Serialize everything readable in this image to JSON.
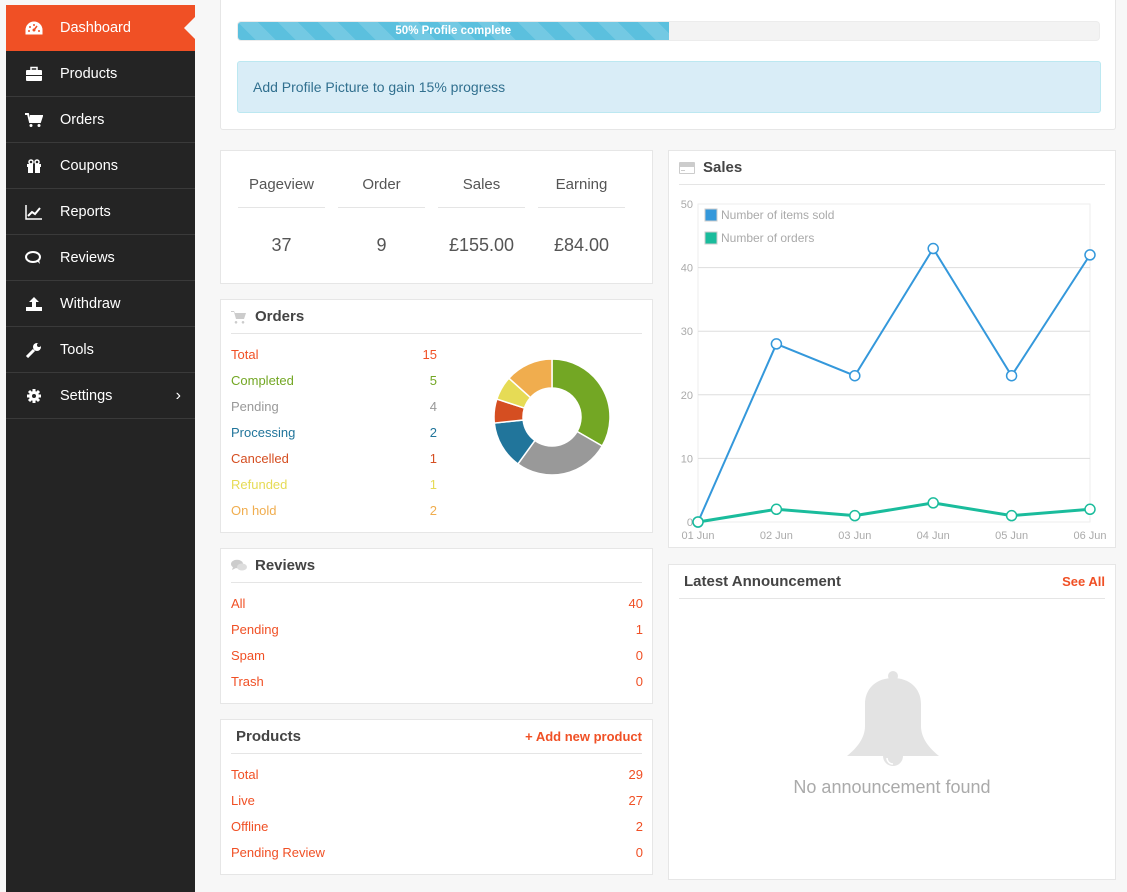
{
  "sidebar": {
    "items": [
      {
        "label": "Dashboard",
        "icon": "dashboard-icon",
        "active": true
      },
      {
        "label": "Products",
        "icon": "briefcase-icon"
      },
      {
        "label": "Orders",
        "icon": "cart-icon"
      },
      {
        "label": "Coupons",
        "icon": "gift-icon"
      },
      {
        "label": "Reports",
        "icon": "line-chart-icon"
      },
      {
        "label": "Reviews",
        "icon": "comments-icon"
      },
      {
        "label": "Withdraw",
        "icon": "upload-icon"
      },
      {
        "label": "Tools",
        "icon": "wrench-icon"
      },
      {
        "label": "Settings",
        "icon": "gear-icon",
        "chevron": "›"
      }
    ]
  },
  "profile": {
    "progress_label": "50% Profile complete",
    "progress_percent": 50,
    "hint": "Add Profile Picture to gain 15% progress"
  },
  "stats": [
    {
      "label": "Pageview",
      "value": "37"
    },
    {
      "label": "Order",
      "value": "9"
    },
    {
      "label": "Sales",
      "value": "£155.00"
    },
    {
      "label": "Earning",
      "value": "£84.00"
    }
  ],
  "orders": {
    "title": "Orders",
    "rows": [
      {
        "label": "Total",
        "value": "15",
        "color": "#f05025"
      },
      {
        "label": "Completed",
        "value": "5",
        "color": "#73a724"
      },
      {
        "label": "Pending",
        "value": "4",
        "color": "#999999"
      },
      {
        "label": "Processing",
        "value": "2",
        "color": "#21759b"
      },
      {
        "label": "Cancelled",
        "value": "1",
        "color": "#d54e21"
      },
      {
        "label": "Refunded",
        "value": "1",
        "color": "#e6db55"
      },
      {
        "label": "On hold",
        "value": "2",
        "color": "#f0ad4e"
      }
    ]
  },
  "reviews": {
    "title": "Reviews",
    "rows": [
      {
        "label": "All",
        "value": "40"
      },
      {
        "label": "Pending",
        "value": "1"
      },
      {
        "label": "Spam",
        "value": "0"
      },
      {
        "label": "Trash",
        "value": "0"
      }
    ]
  },
  "products": {
    "title": "Products",
    "add_link": "+ Add new product",
    "rows": [
      {
        "label": "Total",
        "value": "29"
      },
      {
        "label": "Live",
        "value": "27"
      },
      {
        "label": "Offline",
        "value": "2"
      },
      {
        "label": "Pending Review",
        "value": "0"
      }
    ]
  },
  "sales": {
    "title": "Sales"
  },
  "announcement": {
    "title": "Latest Announcement",
    "see_all": "See All",
    "empty_text": "No announcement found"
  },
  "chart_data": {
    "type": "line",
    "title": "Sales",
    "x": [
      "01 Jun",
      "02 Jun",
      "03 Jun",
      "04 Jun",
      "05 Jun",
      "06 Jun"
    ],
    "series": [
      {
        "name": "Number of items sold",
        "values": [
          0,
          28,
          23,
          43,
          23,
          42
        ],
        "color": "#3498db"
      },
      {
        "name": "Number of orders",
        "values": [
          0,
          2,
          1,
          3,
          1,
          2
        ],
        "color": "#1abc9c"
      }
    ],
    "yticks": [
      0,
      10,
      20,
      30,
      40,
      50
    ],
    "ylim": [
      0,
      50
    ],
    "grid": true,
    "legend": "top-left"
  }
}
